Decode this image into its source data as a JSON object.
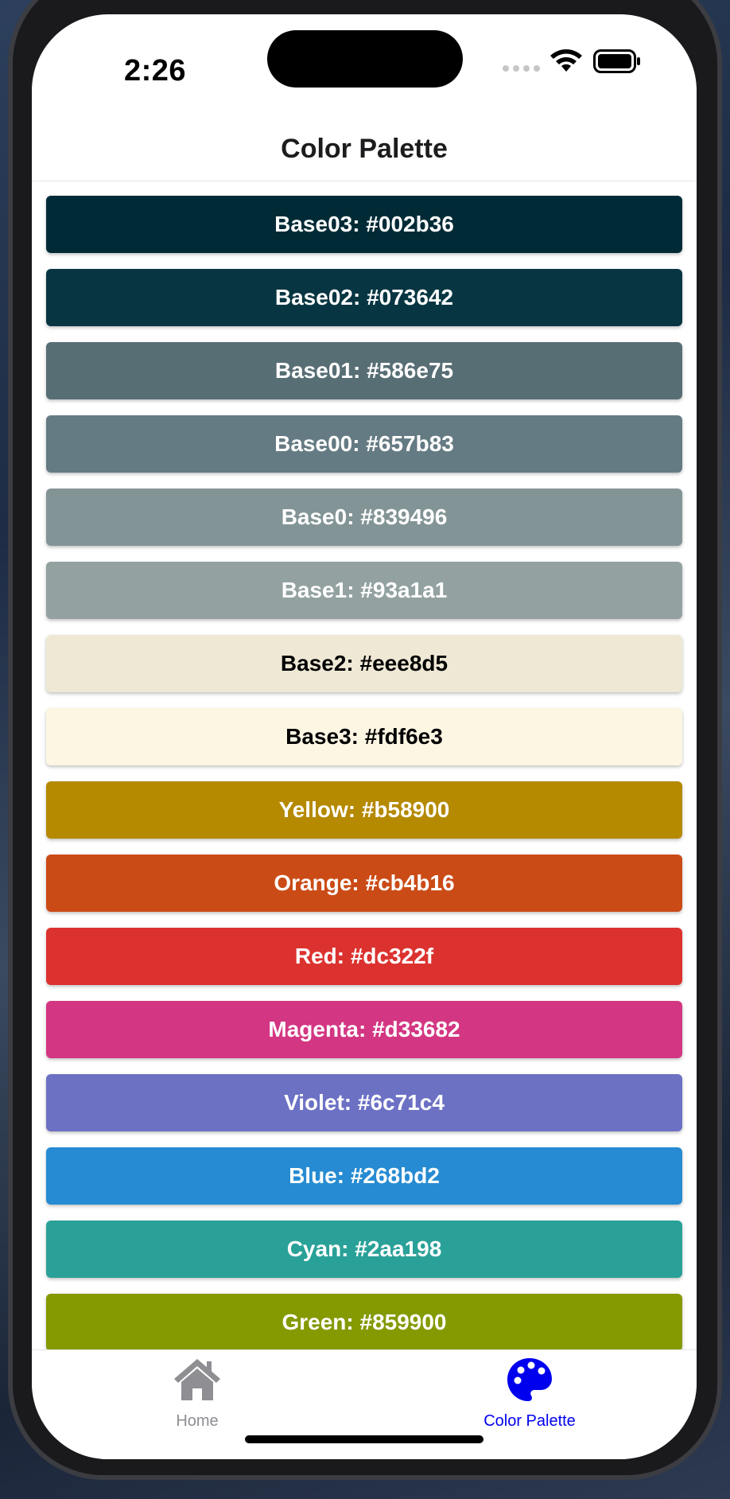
{
  "status_bar": {
    "time": "2:26"
  },
  "header": {
    "title": "Color Palette"
  },
  "swatches": [
    {
      "label": "Base03: #002b36",
      "bg": "#002b36",
      "fg": "#ffffff"
    },
    {
      "label": "Base02: #073642",
      "bg": "#073642",
      "fg": "#ffffff"
    },
    {
      "label": "Base01: #586e75",
      "bg": "#586e75",
      "fg": "#ffffff"
    },
    {
      "label": "Base00: #657b83",
      "bg": "#657b83",
      "fg": "#ffffff"
    },
    {
      "label": "Base0: #839496",
      "bg": "#839496",
      "fg": "#ffffff"
    },
    {
      "label": "Base1: #93a1a1",
      "bg": "#93a1a1",
      "fg": "#ffffff"
    },
    {
      "label": "Base2: #eee8d5",
      "bg": "#eee8d5",
      "fg": "#000000"
    },
    {
      "label": "Base3: #fdf6e3",
      "bg": "#fdf6e3",
      "fg": "#000000"
    },
    {
      "label": "Yellow: #b58900",
      "bg": "#b58900",
      "fg": "#ffffff"
    },
    {
      "label": "Orange: #cb4b16",
      "bg": "#cb4b16",
      "fg": "#ffffff"
    },
    {
      "label": "Red: #dc322f",
      "bg": "#dc322f",
      "fg": "#ffffff"
    },
    {
      "label": "Magenta: #d33682",
      "bg": "#d33682",
      "fg": "#ffffff"
    },
    {
      "label": "Violet: #6c71c4",
      "bg": "#6c71c4",
      "fg": "#ffffff"
    },
    {
      "label": "Blue: #268bd2",
      "bg": "#268bd2",
      "fg": "#ffffff"
    },
    {
      "label": "Cyan: #2aa198",
      "bg": "#2aa198",
      "fg": "#ffffff"
    },
    {
      "label": "Green: #859900",
      "bg": "#859900",
      "fg": "#ffffff"
    }
  ],
  "tab_bar": {
    "home": {
      "label": "Home",
      "icon": "home-icon",
      "color": "#8e8e93"
    },
    "palette": {
      "label": "Color Palette",
      "icon": "palette-icon",
      "color": "#0000ee",
      "active": true
    }
  }
}
